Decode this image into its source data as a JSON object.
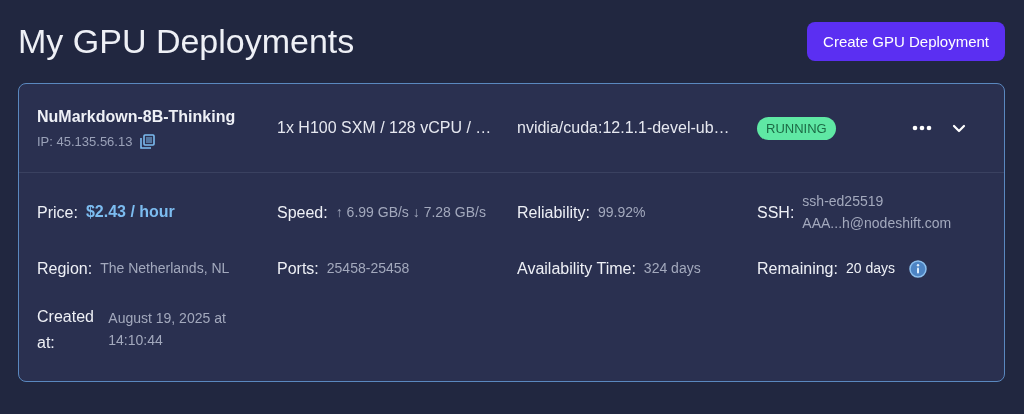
{
  "page_title": "My GPU Deployments",
  "create_button": "Create GPU Deployment",
  "deployment": {
    "name": "NuMarkdown-8B-Thinking",
    "ip": "IP: 45.135.56.13",
    "spec": "1x H100 SXM / 128 vCPU / …",
    "image": "nvidia/cuda:12.1.1-devel-ub…",
    "status": {
      "label": "RUNNING",
      "kind": "running"
    },
    "expanded": true,
    "details": [
      {
        "label": "Price:",
        "value": "$2.43 / hour",
        "kind": "accent"
      },
      {
        "label": "Speed:",
        "value": "↑ 6.99 GB/s ↓ 7.28 GB/s",
        "kind": "plain"
      },
      {
        "label": "Reliability:",
        "value": "99.92%",
        "kind": "plain"
      },
      {
        "label": "SSH:",
        "value": "ssh-ed25519 AAA...h@nodeshift.com",
        "kind": "plain"
      },
      {
        "label": "Region:",
        "value": "The Netherlands, NL",
        "kind": "plain"
      },
      {
        "label": "Ports:",
        "value": "25458-25458",
        "kind": "plain"
      },
      {
        "label": "Availability Time:",
        "value": "324 days",
        "kind": "plain"
      },
      {
        "label": "Remaining:",
        "value": "20 days",
        "kind": "info"
      },
      {
        "label": "Created at:",
        "value": "August 19, 2025 at 14:10:44",
        "kind": "plain"
      }
    ]
  }
}
